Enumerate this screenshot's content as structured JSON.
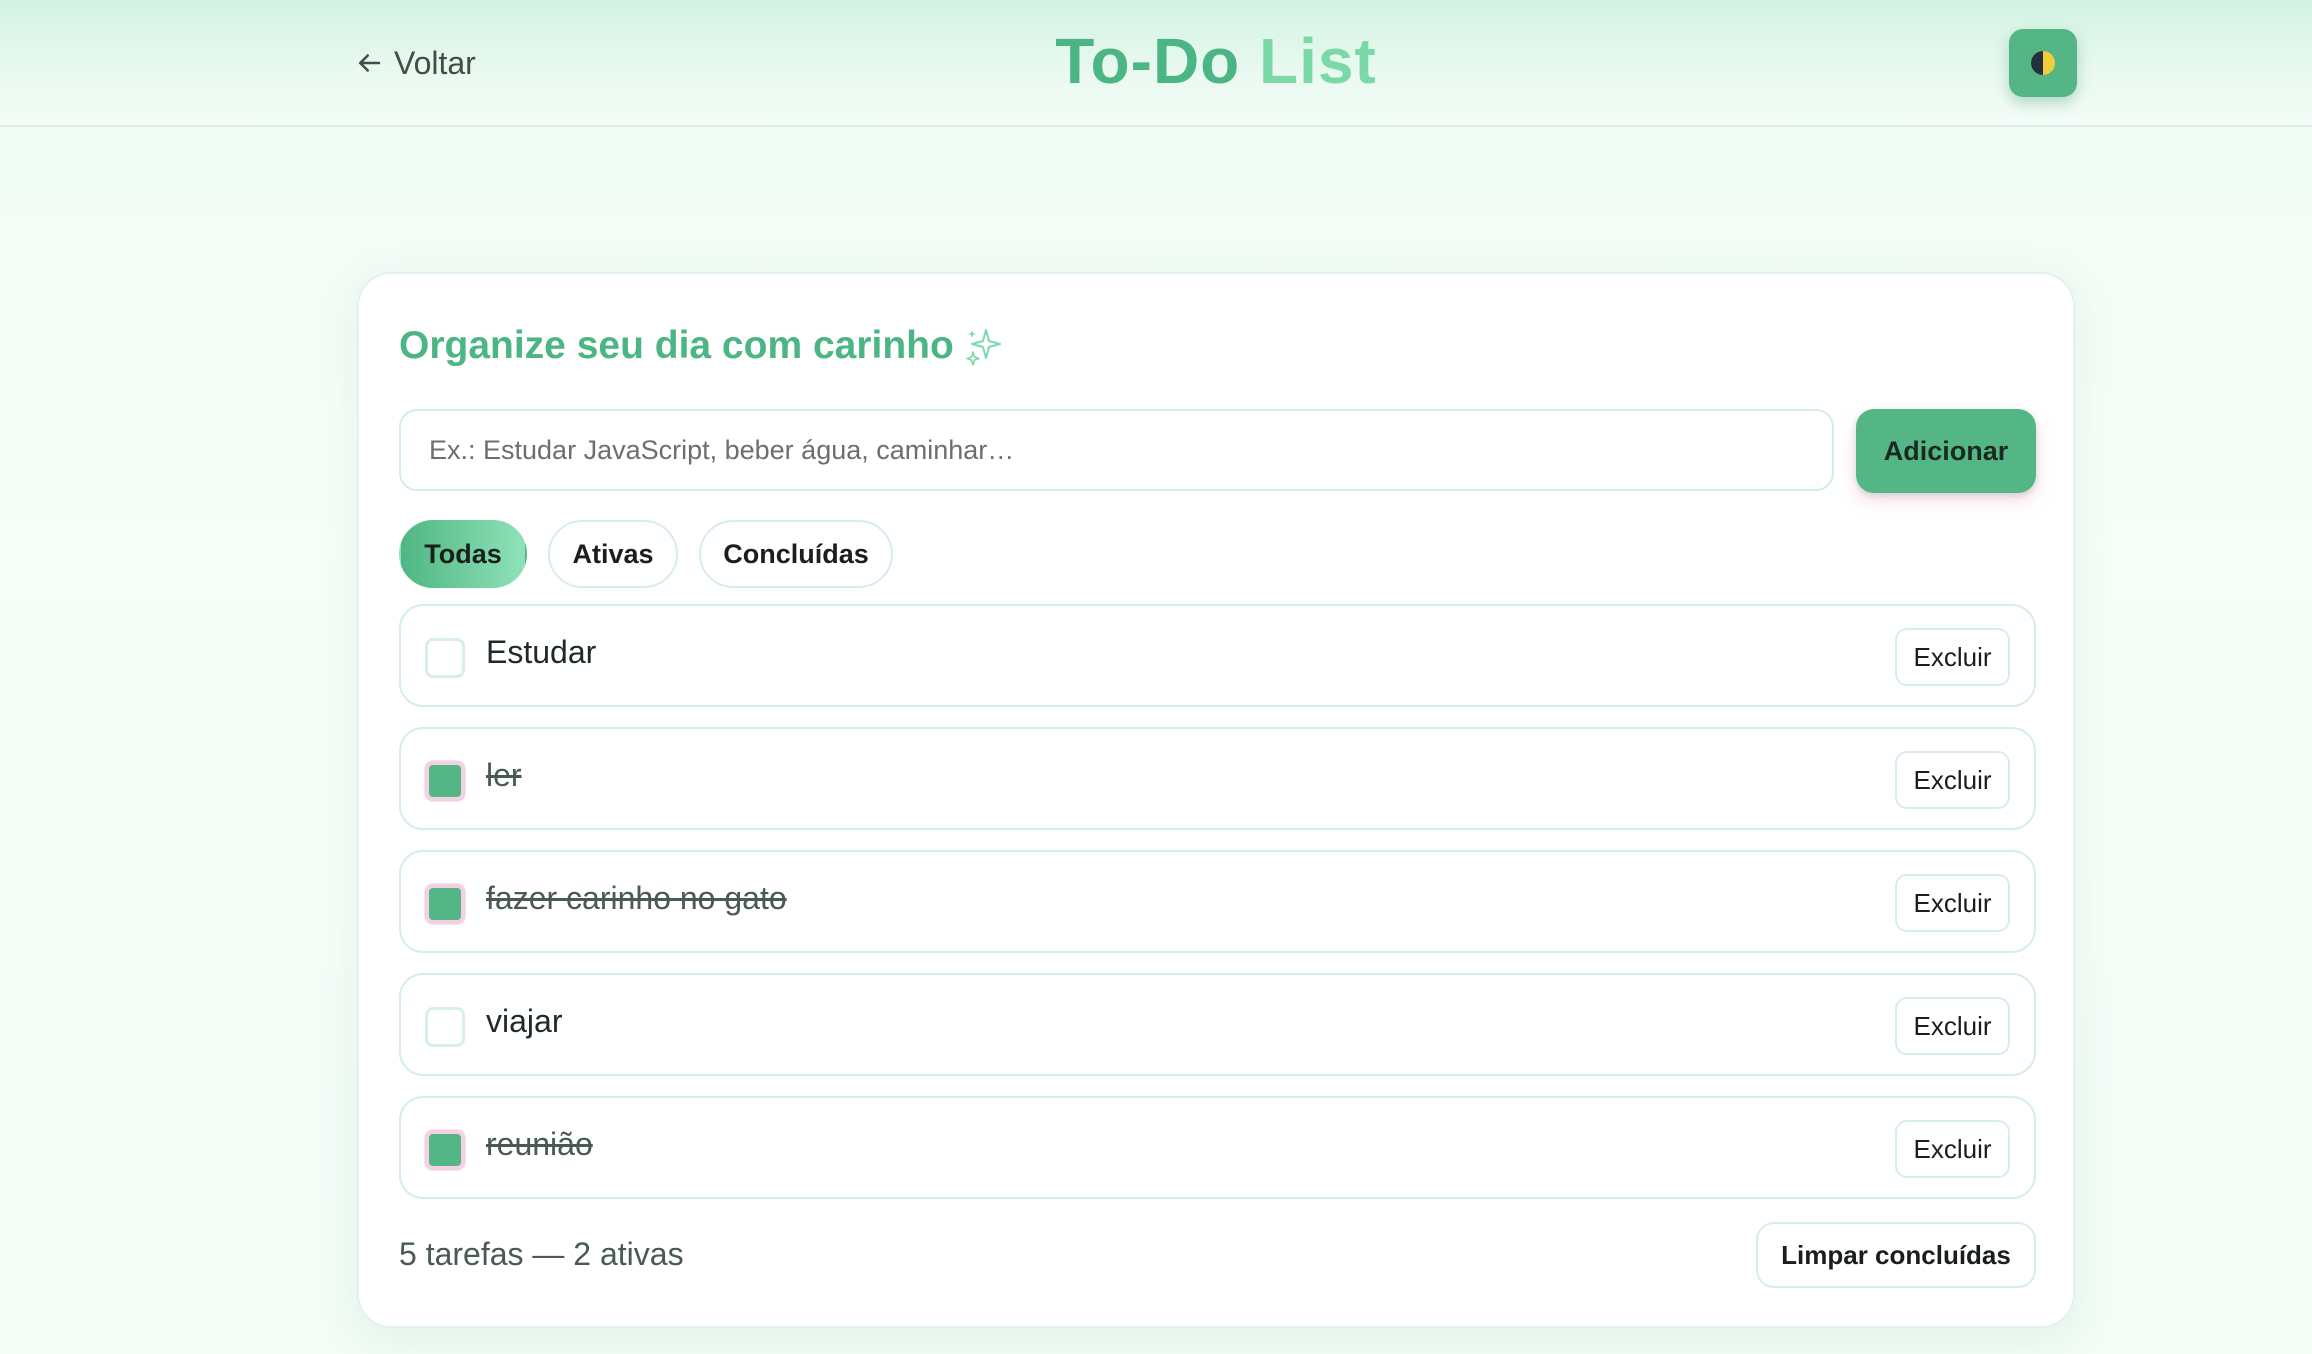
{
  "header": {
    "back_label": "Voltar",
    "title_part1": "To-Do",
    "title_part2": "List",
    "theme_toggle_icon": "half-moon-icon"
  },
  "main": {
    "subtitle": "Organize seu dia com carinho",
    "sparkle_icon": "sparkles-icon",
    "input": {
      "placeholder": "Ex.: Estudar JavaScript, beber água, caminhar…",
      "value": ""
    },
    "add_label": "Adicionar",
    "filters": [
      {
        "label": "Todas",
        "active": true
      },
      {
        "label": "Ativas",
        "active": false
      },
      {
        "label": "Concluídas",
        "active": false
      }
    ],
    "tasks": [
      {
        "text": "Estudar",
        "done": false,
        "delete_label": "Excluir"
      },
      {
        "text": "ler",
        "done": true,
        "delete_label": "Excluir"
      },
      {
        "text": "fazer carinho no gato",
        "done": true,
        "delete_label": "Excluir"
      },
      {
        "text": "viajar",
        "done": false,
        "delete_label": "Excluir"
      },
      {
        "text": "reunião",
        "done": true,
        "delete_label": "Excluir"
      }
    ],
    "summary": "5 tarefas — 2 ativas",
    "clear_label": "Limpar concluídas"
  },
  "colors": {
    "accent": "#55b685",
    "title_light": "#7bd9a8",
    "checkbox_ring": "#f5cfe3"
  }
}
